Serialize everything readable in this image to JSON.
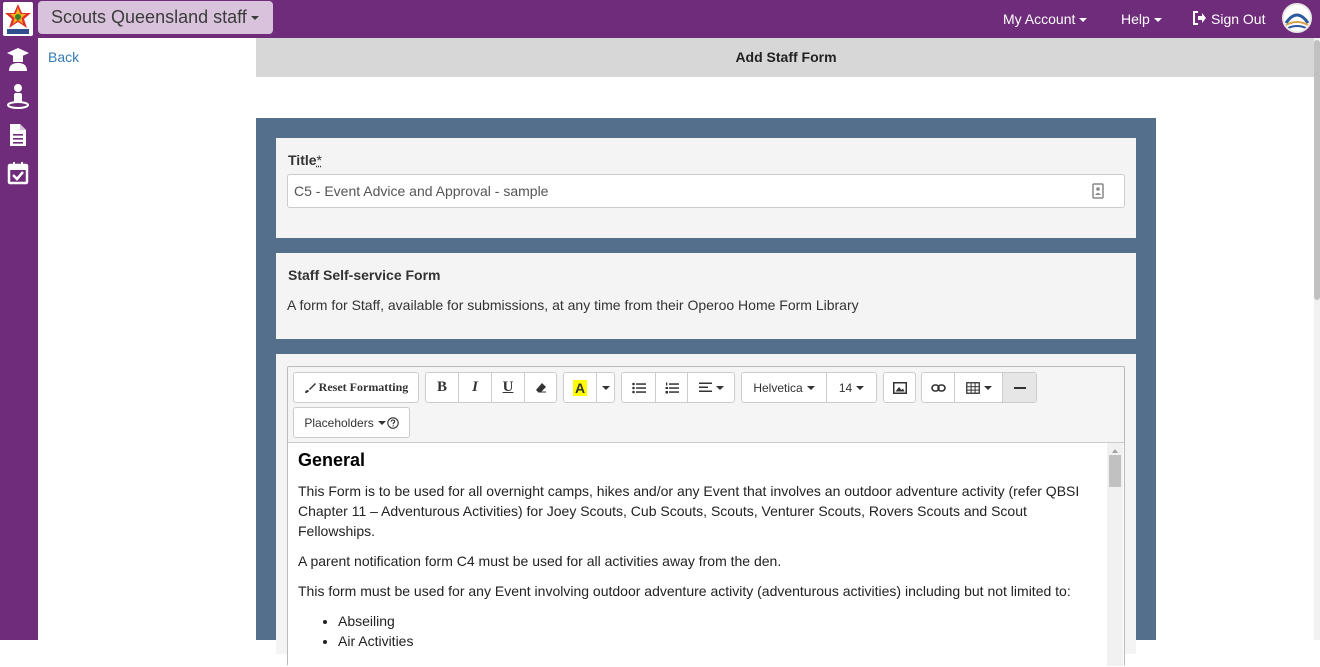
{
  "topbar": {
    "org_name": "Scouts Queensland staff",
    "my_account": "My Account",
    "help": "Help",
    "sign_out": "Sign Out"
  },
  "sidebar": {
    "icons": [
      "graduate-icon",
      "person-icon",
      "document-icon",
      "calendar-check-icon"
    ]
  },
  "page": {
    "back_label": "Back",
    "header_title": "Add Staff Form"
  },
  "form": {
    "title_label": "Title",
    "required_mark": "*",
    "title_value": "C5 - Event Advice and Approval - sample",
    "info_heading": "Staff Self-service Form",
    "info_text": "A form for Staff, available for submissions, at any time from their Operoo Home Form Library"
  },
  "toolbar": {
    "reset_formatting": "Reset Formatting",
    "bold": "B",
    "italic": "I",
    "underline": "U",
    "highlight": "A",
    "font_family": "Helvetica",
    "font_size": "14",
    "placeholders": "Placeholders"
  },
  "editor": {
    "heading": "General",
    "paragraphs": [
      "This Form is to be used for all overnight camps, hikes and/or any Event that involves an outdoor adventure activity (refer QBSI Chapter 11 – Adventurous Activities) for Joey Scouts, Cub Scouts, Scouts, Venturer Scouts, Rovers Scouts and Scout Fellowships.",
      "A parent notification form C4 must be used for all activities away from the den.",
      "This form must be used for any Event involving outdoor adventure activity (adventurous activities) including but not limited to:"
    ],
    "list": [
      "Abseiling",
      "Air Activities"
    ]
  },
  "colors": {
    "brand_purple": "#6e2c7a",
    "form_bg": "#536f8c",
    "link_blue": "#337ab7",
    "highlight_yellow": "#ffff00"
  }
}
